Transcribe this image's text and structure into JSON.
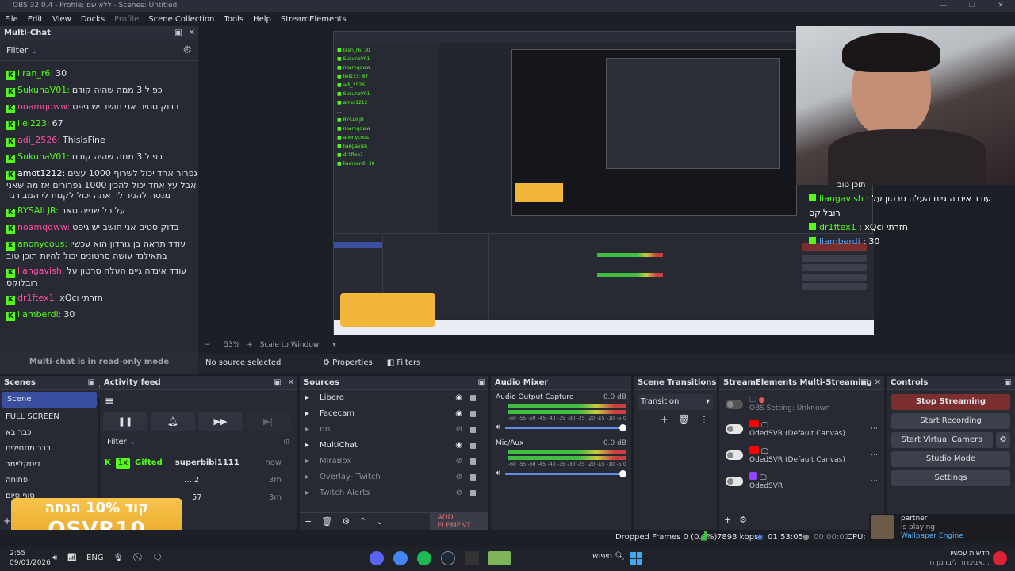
{
  "window": {
    "title": "OBS 32.0.4 - Profile: ללא שם - Scenes: Untitled",
    "controls": [
      "—",
      "❐",
      "✕"
    ]
  },
  "menu": [
    "File",
    "Edit",
    "View",
    "Docks",
    "Profile",
    "Scene Collection",
    "Tools",
    "Help",
    "StreamElements"
  ],
  "multichat": {
    "title": "Multi-Chat",
    "filter_label": "Filter",
    "readonly": "Multi-chat is in read-only mode",
    "messages": [
      {
        "user": "liran_r6:",
        "text": "30",
        "color": "green"
      },
      {
        "user": "SukunaV01:",
        "text": "כפול 3 ממה שהיה קודם",
        "color": "green"
      },
      {
        "user": "noamqqww:",
        "text": "בדוק סטים אני חושב יש גיפט",
        "color": "pink"
      },
      {
        "user": "liel223:",
        "text": "67",
        "color": "green"
      },
      {
        "user": "adi_2526:",
        "text": "ThisIsFine",
        "color": "pink"
      },
      {
        "user": "SukunaV01:",
        "text": "כפול 3 ממה שהיה קודם",
        "color": "green"
      },
      {
        "user": "amot1212:",
        "text": "גפרור אחד יכול לשרוף 1000 עצים אבל עץ אחד יכול להכין 1000 גפרורים אז מה שאני מנסה להגיד לך אתה יכול לקנות לי המבורגר",
        "color": "white"
      },
      {
        "user": "RYSAILJR:",
        "text": "על כל שנייה סאב",
        "color": "green"
      },
      {
        "user": "noamqqww:",
        "text": "בדוק סטים אני חושב יש גיפט",
        "color": "pink"
      },
      {
        "user": "anonycous:",
        "text": "עודד תראה בן גורדון הוא עכשיו בתאילנד עושה סרטונים יכול להיות תוכן טוב",
        "color": "green"
      },
      {
        "user": "liangavish:",
        "text": "עודד אינדה גיים העלה סרטון על רובלוקס",
        "color": "pink"
      },
      {
        "user": "dr1ftex1:",
        "text": "xQcחזרתי ו",
        "color": "pink"
      },
      {
        "user": "liamberdi:",
        "text": "30",
        "color": "green"
      }
    ]
  },
  "preview": {
    "zoom": "53%",
    "scale_label": "Scale to Window",
    "no_source": "No source selected",
    "properties": "Properties",
    "filters": "Filters"
  },
  "overlay_chat": {
    "header": "תוכן טוב",
    "lines": [
      {
        "user": "liangavish",
        "text": ": עודד אינדה גיים העלה סרטון על רובלוקס"
      },
      {
        "user": "dr1ftex1",
        "text": ": xQcחזרתי ו"
      },
      {
        "user": "liamberdi",
        "text": ": 30"
      }
    ]
  },
  "scenes": {
    "title": "Scenes",
    "items": [
      "Scene",
      "FULL SCREEN",
      "כבר בא",
      "כבר מתחילים",
      "דיסקליימר",
      "פתיחה",
      "סוף סיום"
    ]
  },
  "activity": {
    "title": "Activity feed",
    "filter": "Filter",
    "rows": [
      {
        "badge": "1x",
        "type": "Gifted",
        "user": "superbibi1111",
        "time": "now"
      },
      {
        "badge": "",
        "type": "",
        "user": "…i2",
        "time": "3m"
      },
      {
        "badge": "",
        "type": "",
        "user": "57",
        "time": "3m"
      }
    ]
  },
  "sources": {
    "title": "Sources",
    "items": [
      {
        "name": "Libero",
        "visible": true
      },
      {
        "name": "Facecam",
        "visible": true
      },
      {
        "name": "מת",
        "visible": false
      },
      {
        "name": "MultiChat",
        "visible": true
      },
      {
        "name": "MiraBox",
        "visible": false
      },
      {
        "name": "Overlay- Twitch",
        "visible": false
      },
      {
        "name": "Twitch Alerts",
        "visible": false
      }
    ],
    "add_element": "ADD ELEMENT"
  },
  "audio": {
    "title": "Audio Mixer",
    "channels": [
      {
        "name": "Audio Output Capture",
        "db": "0.0 dB"
      },
      {
        "name": "Mic/Aux",
        "db": "0.0 dB"
      }
    ],
    "ticks": [
      "-60",
      "-55",
      "-50",
      "-45",
      "-40",
      "-35",
      "-30",
      "-25",
      "-20",
      "-15",
      "-10",
      "-5",
      "0"
    ]
  },
  "transitions": {
    "title": "Scene Transitions",
    "selected": "Transition"
  },
  "se_multistream": {
    "title": "StreamElements Multi-Streaming",
    "rows": [
      {
        "label": "OBS Setting: Unknown",
        "platform": "none"
      },
      {
        "label": "OdedSVR (Default Canvas)",
        "platform": "youtube"
      },
      {
        "label": "OdedSVR (Default Canvas)",
        "platform": "youtube"
      },
      {
        "label": "OdedSVR",
        "platform": "twitch"
      }
    ]
  },
  "controls": {
    "title": "Controls",
    "stop_streaming": "Stop Streaming",
    "start_recording": "Start Recording",
    "start_virtual_camera": "Start Virtual Camera",
    "studio_mode": "Studio Mode",
    "settings": "Settings"
  },
  "status": {
    "dropped": "Dropped Frames 0 (0.0%)",
    "kbps": "7893 kbps",
    "live_time": "01:53:05",
    "rec_time": "00:00:00",
    "cpu": "CPU: 1"
  },
  "promo": {
    "line1": "קוד 10% הנחה",
    "line2": "OSVR10"
  },
  "now_playing": {
    "user": "partner",
    "status": "is playing",
    "game": "Wallpaper Engine"
  },
  "taskbar": {
    "time": "2:55",
    "date": "09/01/2026",
    "lang": "ENG",
    "search": "חיפוש",
    "news_title": "חדשות עכשיו",
    "news_sub": "אביגדור ליברמן ח..."
  },
  "colors": {
    "accent": "#4a78d4",
    "stop": "#7a2e2e",
    "kick": "#53fc18"
  }
}
